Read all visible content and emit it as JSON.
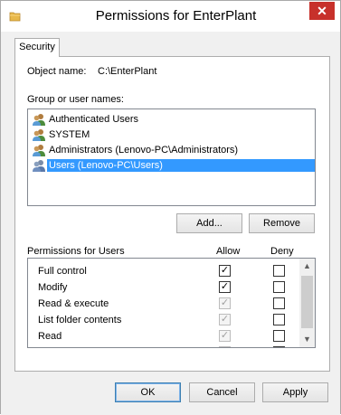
{
  "window": {
    "title": "Permissions for EnterPlant",
    "close_glyph": "✕",
    "app_icon": "folder-icon"
  },
  "tabs": [
    {
      "label": "Security",
      "selected": true
    }
  ],
  "object": {
    "label": "Object name:",
    "value": "C:\\EnterPlant"
  },
  "group_list": {
    "label": "Group or user names:",
    "items": [
      {
        "name": "Authenticated Users",
        "icon": "users-icon",
        "selected": false
      },
      {
        "name": "SYSTEM",
        "icon": "users-icon",
        "selected": false
      },
      {
        "name": "Administrators (Lenovo-PC\\Administrators)",
        "icon": "users-icon",
        "selected": false
      },
      {
        "name": "Users (Lenovo-PC\\Users)",
        "icon": "users-icon",
        "selected": true
      }
    ]
  },
  "group_buttons": {
    "add": "Add...",
    "remove": "Remove"
  },
  "permissions": {
    "label": "Permissions for Users",
    "allow_header": "Allow",
    "deny_header": "Deny",
    "rows": [
      {
        "name": "Full control",
        "allow": true,
        "allow_inherited": false,
        "deny": false
      },
      {
        "name": "Modify",
        "allow": true,
        "allow_inherited": false,
        "deny": false
      },
      {
        "name": "Read & execute",
        "allow": true,
        "allow_inherited": true,
        "deny": false
      },
      {
        "name": "List folder contents",
        "allow": true,
        "allow_inherited": true,
        "deny": false
      },
      {
        "name": "Read",
        "allow": true,
        "allow_inherited": true,
        "deny": false
      },
      {
        "name": "",
        "allow": true,
        "allow_inherited": true,
        "deny": false
      }
    ]
  },
  "dialog_buttons": {
    "ok": "OK",
    "cancel": "Cancel",
    "apply": "Apply"
  },
  "colors": {
    "selection": "#3399ff",
    "close_button": "#c7312b",
    "dialog_background": "#f0f0f0"
  }
}
